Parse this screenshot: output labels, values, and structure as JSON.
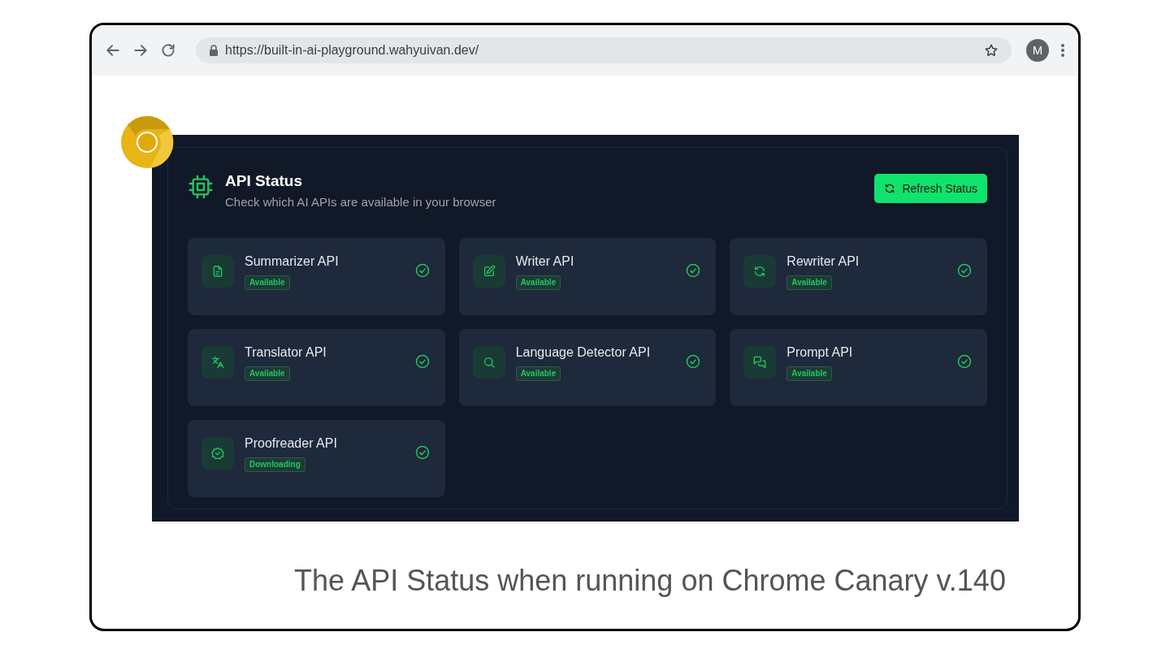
{
  "browser": {
    "url": "https://built-in-ai-playground.wahyuivan.dev/",
    "profile_initial": "M"
  },
  "panel": {
    "title": "API Status",
    "subtitle": "Check which AI APIs are available in your browser",
    "button": "Refresh Status"
  },
  "apis": [
    {
      "name": "Summarizer API",
      "status": "Available",
      "kind": "document"
    },
    {
      "name": "Writer API",
      "status": "Available",
      "kind": "pencil"
    },
    {
      "name": "Rewriter API",
      "status": "Available",
      "kind": "refresh"
    },
    {
      "name": "Translator API",
      "status": "Available",
      "kind": "translate"
    },
    {
      "name": "Language Detector API",
      "status": "Available",
      "kind": "search"
    },
    {
      "name": "Prompt API",
      "status": "Available",
      "kind": "chat"
    },
    {
      "name": "Proofreader API",
      "status": "Downloading",
      "kind": "badge"
    }
  ],
  "caption": "The API Status when running on Chrome Canary v.140"
}
